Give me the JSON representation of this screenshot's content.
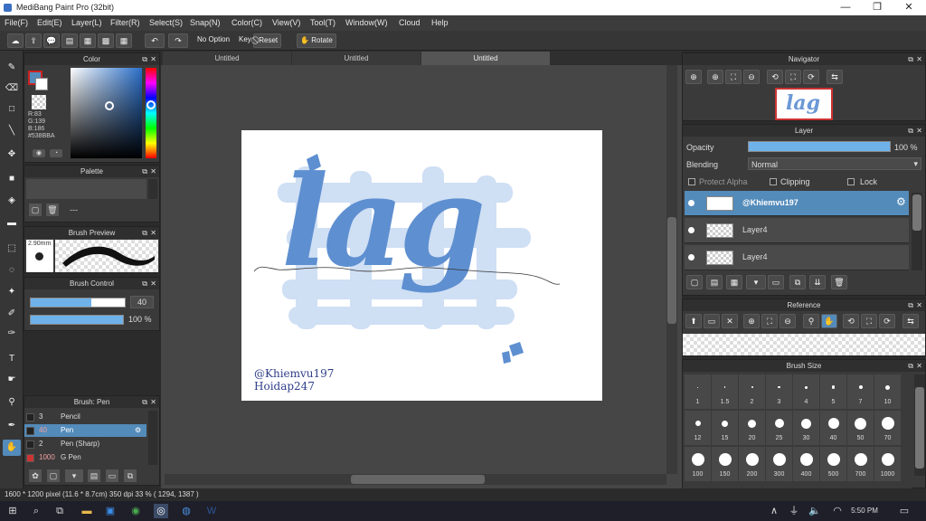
{
  "window": {
    "title": "MediBang Paint Pro (32bit)",
    "min": "—",
    "max": "❐",
    "close": "✕"
  },
  "menu": [
    "File(F)",
    "Edit(E)",
    "Layer(L)",
    "Filter(R)",
    "Select(S)",
    "Snap(N)",
    "Color(C)",
    "View(V)",
    "Tool(T)",
    "Window(W)",
    "Cloud",
    "Help"
  ],
  "toolbar": {
    "no_option": "No Option",
    "key": "Key",
    "reset": "Reset",
    "rotate": "Rotate"
  },
  "tabs": [
    "Untitled",
    "Untitled",
    "Untitled"
  ],
  "color_panel": {
    "title": "Color",
    "r": "R:83",
    "g": "G:139",
    "b": "B:186",
    "hex": "#538BBA",
    "main": "#538bba"
  },
  "palette_panel": {
    "title": "Palette",
    "dashes": "---"
  },
  "brush_preview": {
    "title": "Brush Preview",
    "size": "2.90mm"
  },
  "brush_control": {
    "title": "Brush Control",
    "size_value": "40",
    "opacity_value": "100 %",
    "size_fraction": 0.64,
    "opacity_fraction": 1.0
  },
  "brush_list": {
    "title": "Brush: Pen",
    "items": [
      {
        "num": "3",
        "name": "Pencil",
        "selected": false
      },
      {
        "num": "40",
        "name": "Pen",
        "selected": true
      },
      {
        "num": "2",
        "name": "Pen (Sharp)",
        "selected": false
      },
      {
        "num": "1000",
        "name": "G Pen",
        "selected": false
      }
    ]
  },
  "artwork": {
    "word": "lag",
    "signature1": "@Khiemvu197",
    "signature2": "Hoidap247"
  },
  "navigator": {
    "title": "Navigator"
  },
  "layer_panel": {
    "title": "Layer",
    "opacity_label": "Opacity",
    "opacity_value": "100 %",
    "blending_label": "Blending",
    "blending_value": "Normal",
    "protect_alpha": "Protect Alpha",
    "clipping": "Clipping",
    "lock": "Lock",
    "layers": [
      {
        "name": "@Khiemvu197",
        "selected": true
      },
      {
        "name": "Layer4",
        "selected": false
      },
      {
        "name": "Layer4",
        "selected": false
      }
    ]
  },
  "reference_panel": {
    "title": "Reference"
  },
  "brush_size_panel": {
    "title": "Brush Size",
    "rows": [
      [
        "1",
        "1.5",
        "2",
        "3",
        "4",
        "5",
        "7",
        "10"
      ],
      [
        "12",
        "15",
        "20",
        "25",
        "30",
        "40",
        "50",
        "70"
      ],
      [
        "100",
        "150",
        "200",
        "300",
        "400",
        "500",
        "700",
        "1000"
      ]
    ]
  },
  "status": {
    "text": "1600 * 1200 pixel   (11.6 * 8.7cm)   350 dpi   33 %   ( 1294, 1387 )"
  },
  "taskbar": {
    "time": "5:50 PM"
  }
}
